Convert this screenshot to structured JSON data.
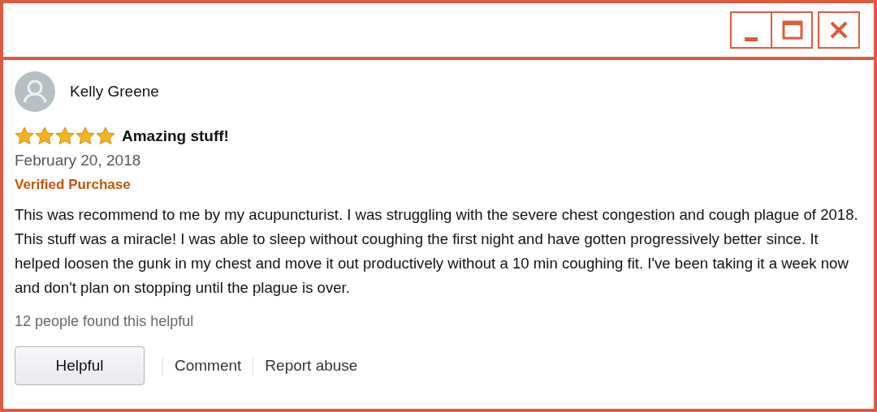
{
  "window": {
    "controls": [
      {
        "kind": "minimize"
      },
      {
        "kind": "maximize"
      },
      {
        "kind": "close"
      }
    ]
  },
  "review": {
    "author": "Kelly Greene",
    "stars": 5,
    "title": "Amazing stuff!",
    "date": "February 20, 2018",
    "badge": "Verified Purchase",
    "body": "This was recommend to me by my acupuncturist. I was struggling with the severe chest congestion and cough plague of 2018. This stuff was a miracle! I was able to sleep without coughing the first night and have gotten progressively better since. It helped loosen the gunk in my chest and move it out productively without a 10 min coughing fit. I've been taking it a week now and don't plan on stopping until the plague is over.",
    "helpful_count": "12 people found this helpful",
    "actions": [
      {
        "kind": "button",
        "label": "Helpful"
      },
      {
        "kind": "link",
        "label": "Comment"
      },
      {
        "kind": "link",
        "label": "Report abuse"
      }
    ]
  }
}
